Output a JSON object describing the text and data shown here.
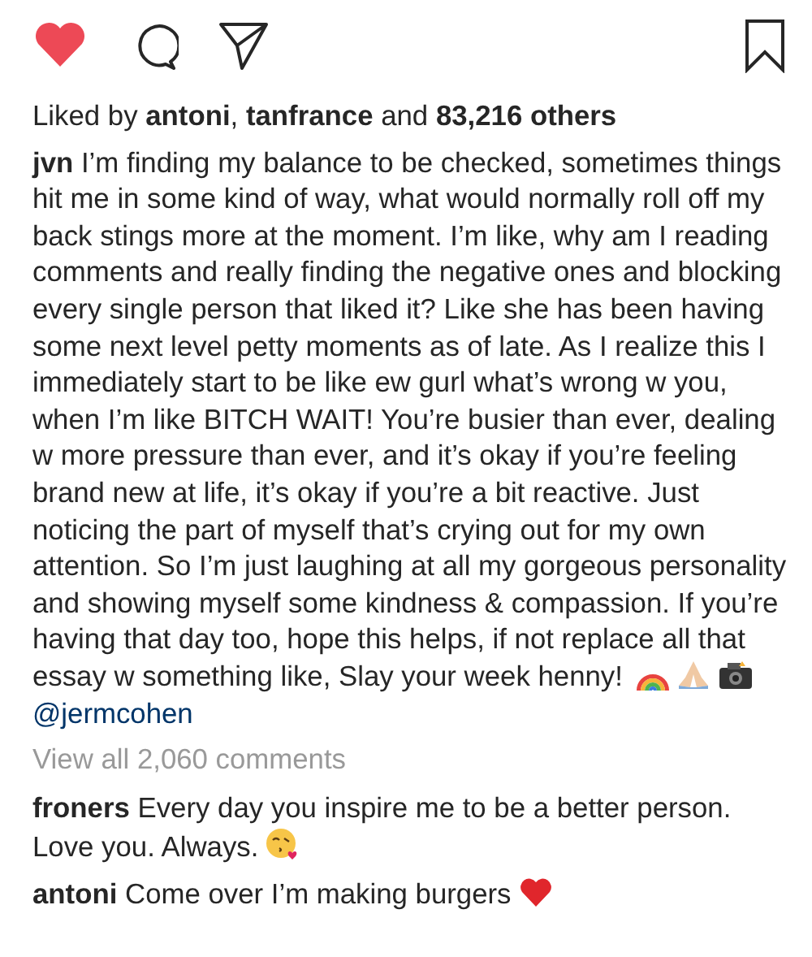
{
  "actions": {
    "liked": true,
    "saved": false
  },
  "likes": {
    "text": "Liked by **antoni**, **tanfrance** and **83,216 others**"
  },
  "caption": {
    "user": "jvn",
    "text": "I’m finding my balance to be checked, sometimes things hit me in some kind of way, what would normally roll off my back stings more at the moment. I’m like, why am I reading comments and really finding the negative ones and blocking every single person that liked it? Like she has been having some next level petty moments as of late.  As I realize this I immediately start to be like ew gurl what’s wrong w you, when I’m like BITCH WAIT! You’re busier than ever, dealing w more pressure than ever, and it’s okay if you’re feeling brand new at life, it’s okay if you’re a bit reactive. Just noticing the part of myself that’s crying out for my own attention. So I’m just laughing at all my gorgeous personality and showing myself some kindness & compassion. If you’re having that day too, hope this helps, if not replace all that essay w something like, Slay your week henny!",
    "mention": "@jermcohen"
  },
  "view_all": "View all 2,060 comments",
  "comments": [
    {
      "user": "froners",
      "text": "Every day you inspire me to be a better person. Love you. Always."
    },
    {
      "user": "antoni",
      "text": "Come over I’m making burgers"
    }
  ]
}
